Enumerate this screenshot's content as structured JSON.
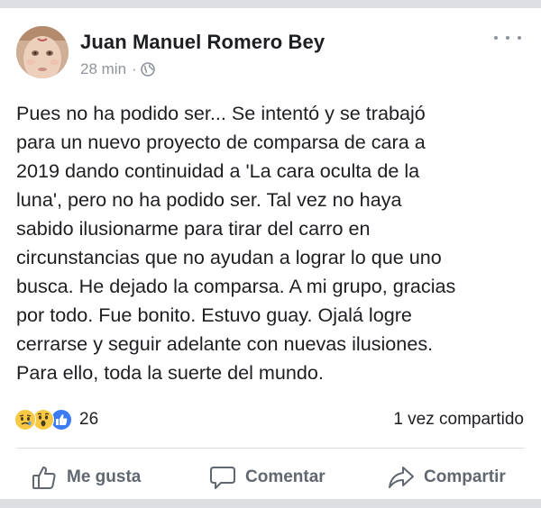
{
  "post": {
    "author": "Juan Manuel Romero Bey",
    "time": "28 min",
    "separator": "·",
    "text": "Pues no ha podido ser... Se intentó y se trabajó\npara un nuevo proyecto de comparsa de cara a\n2019 dando continuidad a 'La cara oculta de la\nluna', pero no ha podido ser. Tal vez no haya\nsabido ilusionarme para tirar del carro en\ncircunstancias que no ayudan a lograr lo que uno\nbusca. He dejado la comparsa. A mi grupo, gracias\npor todo. Fue bonito. Estuvo guay. Ojalá logre\ncerrarse y seguir adelante con nuevas ilusiones.\nPara ello, toda la suerte del mundo.",
    "reactions": {
      "icons": [
        "sad-icon",
        "wow-icon",
        "like-icon"
      ],
      "count": "26"
    },
    "shares": "1 vez compartido"
  },
  "actions": {
    "like": "Me gusta",
    "comment": "Comentar",
    "share": "Compartir"
  },
  "colors": {
    "background": "#dddfe2",
    "card": "#ffffff",
    "text": "#1c1e21",
    "muted": "#90949c",
    "action_text": "#606770",
    "like_blue": "#3b7bf3",
    "emoji_yellow": "#f7c945"
  }
}
